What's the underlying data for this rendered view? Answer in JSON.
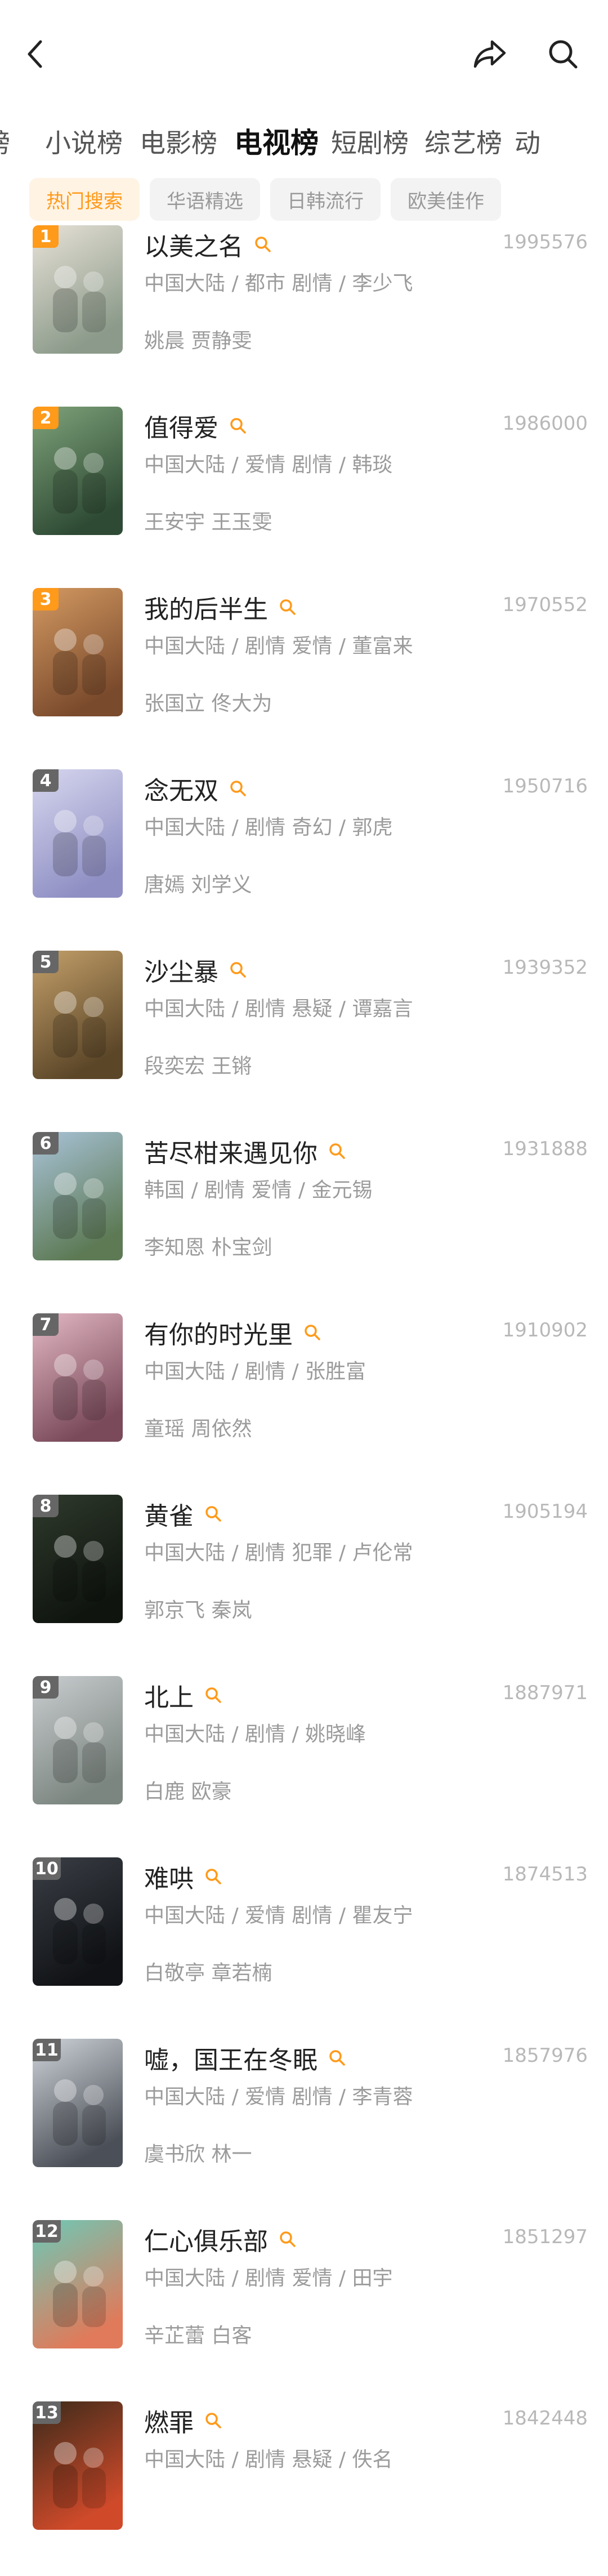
{
  "colors": {
    "accent": "#ff9a1a",
    "rank_top": "#ff9a1a",
    "rank_default": "#666666"
  },
  "header": {
    "back_icon": "chevron-left-icon",
    "share_icon": "share-icon",
    "search_icon": "search-icon"
  },
  "tabs": [
    {
      "label": "榜"
    },
    {
      "label": "小说榜"
    },
    {
      "label": "电影榜"
    },
    {
      "label": "电视榜",
      "active": true
    },
    {
      "label": "短剧榜"
    },
    {
      "label": "综艺榜"
    },
    {
      "label": "动"
    }
  ],
  "chips": [
    {
      "label": "热门搜索",
      "active": true
    },
    {
      "label": "华语精选"
    },
    {
      "label": "日韩流行"
    },
    {
      "label": "欧美佳作"
    }
  ],
  "items": [
    {
      "rank": "1",
      "title": "以美之名",
      "score": "1995576",
      "meta": "中国大陆 / 都市 剧情 / 李少飞",
      "cast": "姚晨 贾静雯",
      "poster": [
        "#e8e2d8",
        "#8b9a8a"
      ]
    },
    {
      "rank": "2",
      "title": "值得爱",
      "score": "1986000",
      "meta": "中国大陆 / 爱情 剧情 / 韩琰",
      "cast": "王安宇 王玉雯",
      "poster": [
        "#7fa37a",
        "#2e4a34"
      ]
    },
    {
      "rank": "3",
      "title": "我的后半生",
      "score": "1970552",
      "meta": "中国大陆 / 剧情 爱情 / 董富来",
      "cast": "张国立 佟大为",
      "poster": [
        "#d49a62",
        "#7a4a2c"
      ]
    },
    {
      "rank": "4",
      "title": "念无双",
      "score": "1950716",
      "meta": "中国大陆 / 剧情 奇幻 / 郭虎",
      "cast": "唐嫣 刘学义",
      "poster": [
        "#d7d7ef",
        "#8f8fc4"
      ]
    },
    {
      "rank": "5",
      "title": "沙尘暴",
      "score": "1939352",
      "meta": "中国大陆 / 剧情 悬疑 / 谭嘉言",
      "cast": "段奕宏 王锵",
      "poster": [
        "#c4a06a",
        "#5b4628"
      ]
    },
    {
      "rank": "6",
      "title": "苦尽柑来遇见你",
      "score": "1931888",
      "meta": "韩国 / 剧情 爱情 / 金元锡",
      "cast": "李知恩 朴宝剑",
      "poster": [
        "#a9c3d8",
        "#5d7a55"
      ]
    },
    {
      "rank": "7",
      "title": "有你的时光里",
      "score": "1910902",
      "meta": "中国大陆 / 剧情 / 张胜富",
      "cast": "童瑶 周依然",
      "poster": [
        "#e4b8c4",
        "#7a4a5a"
      ]
    },
    {
      "rank": "8",
      "title": "黄雀",
      "score": "1905194",
      "meta": "中国大陆 / 剧情 犯罪 / 卢伦常",
      "cast": "郭京飞 秦岚",
      "poster": [
        "#2f3a2c",
        "#0f140f"
      ]
    },
    {
      "rank": "9",
      "title": "北上",
      "score": "1887971",
      "meta": "中国大陆 / 剧情 / 姚晓峰",
      "cast": "白鹿 欧豪",
      "poster": [
        "#c9cdd0",
        "#7c8680"
      ]
    },
    {
      "rank": "10",
      "title": "难哄",
      "score": "1874513",
      "meta": "中国大陆 / 爱情 剧情 / 瞿友宁",
      "cast": "白敬亭 章若楠",
      "poster": [
        "#3a3f46",
        "#101215"
      ]
    },
    {
      "rank": "11",
      "title": "嘘，国王在冬眠",
      "score": "1857976",
      "meta": "中国大陆 / 爱情 剧情 / 李青蓉",
      "cast": "虞书欣 林一",
      "poster": [
        "#cfd4da",
        "#4b4f57"
      ]
    },
    {
      "rank": "12",
      "title": "仁心俱乐部",
      "score": "1851297",
      "meta": "中国大陆 / 剧情 爱情 / 田宇",
      "cast": "辛芷蕾 白客",
      "poster": [
        "#6ccab8",
        "#e07a5a"
      ]
    },
    {
      "rank": "13",
      "title": "燃罪",
      "score": "1842448",
      "meta": "中国大陆 / 剧情 悬疑 / 佚名",
      "cast": "",
      "poster": [
        "#3a2a1a",
        "#d04a2a"
      ]
    }
  ]
}
